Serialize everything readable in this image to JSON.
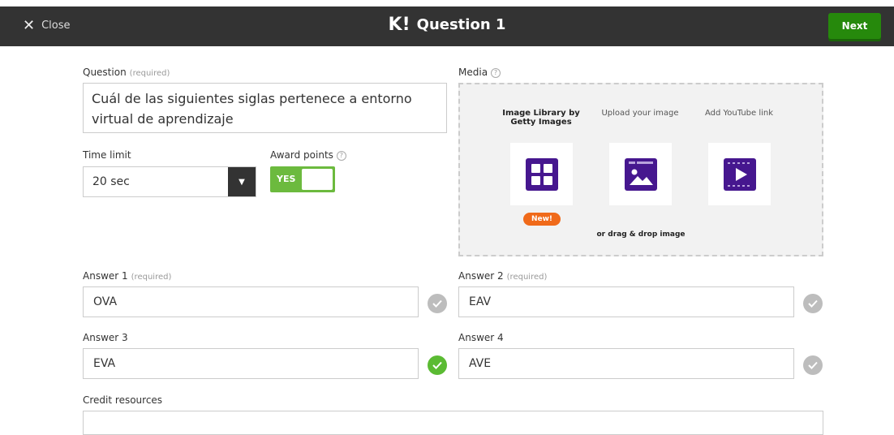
{
  "header": {
    "close_label": "Close",
    "logo": "K!",
    "title": "Question 1",
    "next_label": "Next"
  },
  "question": {
    "label": "Question",
    "required": "(required)",
    "text": "Cuál de las siguientes siglas pertenece a entorno virtual de aprendizaje"
  },
  "time_limit": {
    "label": "Time limit",
    "value": "20 sec"
  },
  "award_points": {
    "label": "Award points",
    "toggle_label": "YES",
    "enabled": true
  },
  "media": {
    "label": "Media",
    "options": [
      {
        "label": "Image Library by Getty Images",
        "icon": "grid-icon"
      },
      {
        "label": "Upload your image",
        "icon": "image-upload-icon"
      },
      {
        "label": "Add YouTube link",
        "icon": "video-icon"
      }
    ],
    "new_badge": "New!",
    "drag_text": "or drag & drop image"
  },
  "answers": [
    {
      "label": "Answer 1",
      "required": "(required)",
      "value": "OVA",
      "correct": false
    },
    {
      "label": "Answer 2",
      "required": "(required)",
      "value": "EAV",
      "correct": false
    },
    {
      "label": "Answer 3",
      "required": "",
      "value": "EVA",
      "correct": true
    },
    {
      "label": "Answer 4",
      "required": "",
      "value": "AVE",
      "correct": false
    }
  ],
  "credit": {
    "label": "Credit resources"
  },
  "colors": {
    "topbar": "#333333",
    "next_button": "#26890c",
    "toggle_on": "#6cba3e",
    "correct": "#5bbb33",
    "icon_purple": "#46178f",
    "new_badge": "#f06a1a"
  }
}
